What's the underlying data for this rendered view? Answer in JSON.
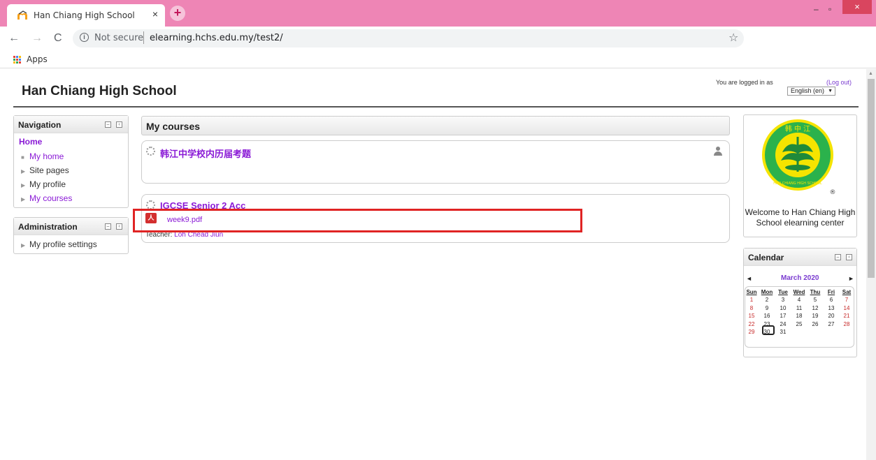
{
  "browser": {
    "tab_title": "Han Chiang High School",
    "tab_close": "×",
    "new_tab": "+",
    "minimize": "–",
    "maximize": "▫",
    "close": "×",
    "address_security": "Not secure",
    "address_url": "elearning.hchs.edu.my/test2/",
    "bookmarks_apps": "Apps"
  },
  "header": {
    "site_title": "Han Chiang High School",
    "login_text": "You are logged in as",
    "logout": "(Log out)",
    "language": "English (en)"
  },
  "navigation": {
    "title": "Navigation",
    "home": "Home",
    "items": [
      {
        "label": "My home",
        "link": true
      },
      {
        "label": "Site pages",
        "link": false
      },
      {
        "label": "My profile",
        "link": false
      },
      {
        "label": "My courses",
        "link": true
      }
    ]
  },
  "administration": {
    "title": "Administration",
    "items": [
      {
        "label": "My profile settings"
      }
    ]
  },
  "main": {
    "title": "My courses",
    "courses": [
      {
        "name": "韩江中学校内历届考题"
      },
      {
        "name": "IGCSE Senior 2 Acc",
        "file": "week9.pdf",
        "teacher_label": "Teacher:",
        "teacher_name": "Loh Chead Jiun"
      }
    ]
  },
  "logo_block": {
    "welcome": "Welcome to Han Chiang High School elearning center",
    "logo_text_top": "韩 中 江",
    "logo_text_bottom": "HAN CHIANG HIGH SCHOOL",
    "registered": "®"
  },
  "calendar": {
    "title": "Calendar",
    "month": "March 2020",
    "prev": "◄",
    "next": "►",
    "days": [
      "Sun",
      "Mon",
      "Tue",
      "Wed",
      "Thu",
      "Fri",
      "Sat"
    ],
    "weeks": [
      [
        "1",
        "2",
        "3",
        "4",
        "5",
        "6",
        "7"
      ],
      [
        "8",
        "9",
        "10",
        "11",
        "12",
        "13",
        "14"
      ],
      [
        "15",
        "16",
        "17",
        "18",
        "19",
        "20",
        "21"
      ],
      [
        "22",
        "23",
        "24",
        "25",
        "26",
        "27",
        "28"
      ],
      [
        "29",
        "30",
        "31",
        "",
        "",
        "",
        ""
      ]
    ],
    "today": "23"
  },
  "colors": {
    "accent": "#8a1ad6",
    "tabbar": "#ee85b5",
    "highlight": "#e02424"
  }
}
